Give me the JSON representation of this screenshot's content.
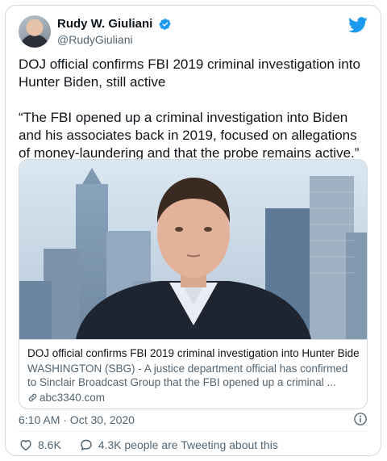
{
  "author": {
    "display_name": "Rudy W. Giuliani",
    "handle": "@RudyGiuliani"
  },
  "tweet": {
    "paragraph1": "DOJ official confirms FBI 2019 criminal investigation into Hunter Biden, still active",
    "paragraph2": "“The FBI opened up a criminal investigation into Biden and his associates back in 2019, focused on allegations of money-laundering and that the probe remains active.”"
  },
  "link_card": {
    "title": "DOJ official confirms FBI 2019 criminal investigation into Hunter Bide...",
    "description": "WASHINGTON (SBG) - A justice department official has confirmed to Sinclair Broadcast Group that the FBI opened up a criminal ...",
    "domain": "abc3340.com"
  },
  "timestamp": "6:10 AM · Oct 30, 2020",
  "actions": {
    "likes": "8.6K",
    "replies_text": "4.3K people are Tweeting about this"
  },
  "colors": {
    "twitter_blue": "#1d9bf0",
    "text_primary": "#0f1419",
    "text_secondary": "#536471",
    "border": "#cfd9de"
  },
  "icons": [
    "twitter-bird-icon",
    "verified-badge-icon",
    "link-icon",
    "info-icon",
    "heart-icon",
    "speech-bubble-icon"
  ]
}
